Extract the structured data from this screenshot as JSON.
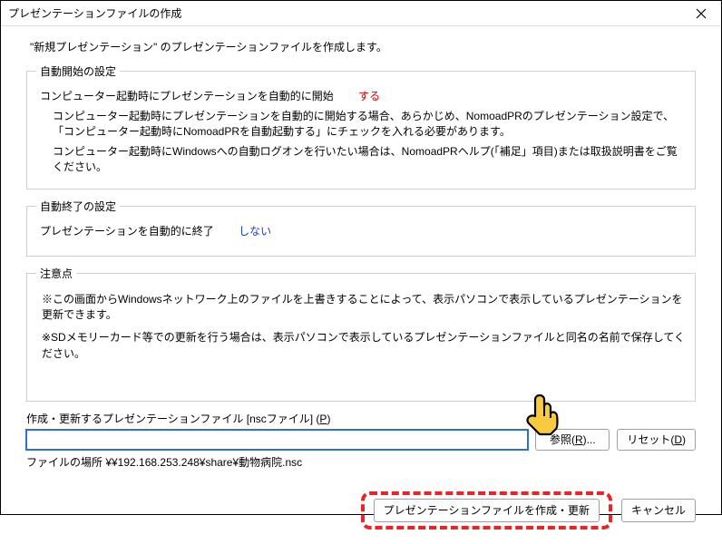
{
  "title": "プレゼンテーションファイルの作成",
  "intro": "\"新規プレゼンテーション\" のプレゼンテーションファイルを作成します。",
  "autoStart": {
    "legend": "自動開始の設定",
    "label": "コンピューター起動時にプレゼンテーションを自動的に開始",
    "value": "する",
    "note1": "コンピューター起動時にプレゼンテーションを自動的に開始する場合、あらかじめ、NomoadPRのプレゼンテーション設定で、「コンピューター起動時にNomoadPRを自動起動する」にチェックを入れる必要があります。",
    "note2": "コンピューター起動時にWindowsへの自動ログオンを行いたい場合は、NomoadPRヘルプ(「補足」項目)または取扱説明書をご覧ください。"
  },
  "autoEnd": {
    "legend": "自動終了の設定",
    "label": "プレゼンテーションを自動的に終了",
    "value": "しない"
  },
  "notes": {
    "legend": "注意点",
    "n1": "※この画面からWindowsネットワーク上のファイルを上書きすることによって、表示パソコンで表示しているプレゼンテーションを更新できます。",
    "n2": "※SDメモリーカード等での更新を行う場合は、表示パソコンで表示しているプレゼンテーションファイルと同名の名前で保存してください。"
  },
  "file": {
    "label_pre": "作成・更新するプレゼンテーションファイル [nscファイル] (",
    "label_key": "P",
    "label_post": ")",
    "value": "",
    "browse_pre": "参照(",
    "browse_key": "R",
    "browse_post": ")...",
    "reset_pre": "リセット(",
    "reset_key": "D",
    "reset_post": ")",
    "location": "ファイルの場所  ¥¥192.168.253.248¥share¥動物病院.nsc"
  },
  "footer": {
    "create": "プレゼンテーションファイルを作成・更新",
    "cancel": "キャンセル"
  }
}
